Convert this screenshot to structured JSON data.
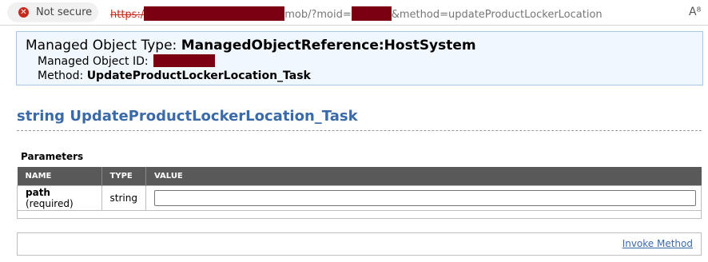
{
  "address_bar": {
    "security_label": "Not secure",
    "url_scheme": "https:/",
    "url_mid": "mob/?moid=",
    "url_tail": "&method=updateProductLockerLocation"
  },
  "header": {
    "type_label": "Managed Object Type:",
    "type_value": "ManagedObjectReference:HostSystem",
    "id_label": "Managed Object ID:",
    "method_label": "Method:",
    "method_value": "UpdateProductLockerLocation_Task"
  },
  "method_title": "string UpdateProductLockerLocation_Task",
  "parameters": {
    "heading": "Parameters",
    "columns": [
      "NAME",
      "TYPE",
      "VALUE"
    ],
    "rows": [
      {
        "name": "path",
        "qualifier": "(required)",
        "type": "string",
        "value": ""
      }
    ]
  },
  "invoke_label": "Invoke Method",
  "colors": {
    "link_blue": "#3b6aa8",
    "header_bg": "#f0f7fd",
    "table_header_bg": "#595959",
    "redaction": "#7a0012",
    "error_red": "#c42b1c"
  },
  "icons": [
    "not-secure-icon",
    "reader-mode-icon"
  ]
}
